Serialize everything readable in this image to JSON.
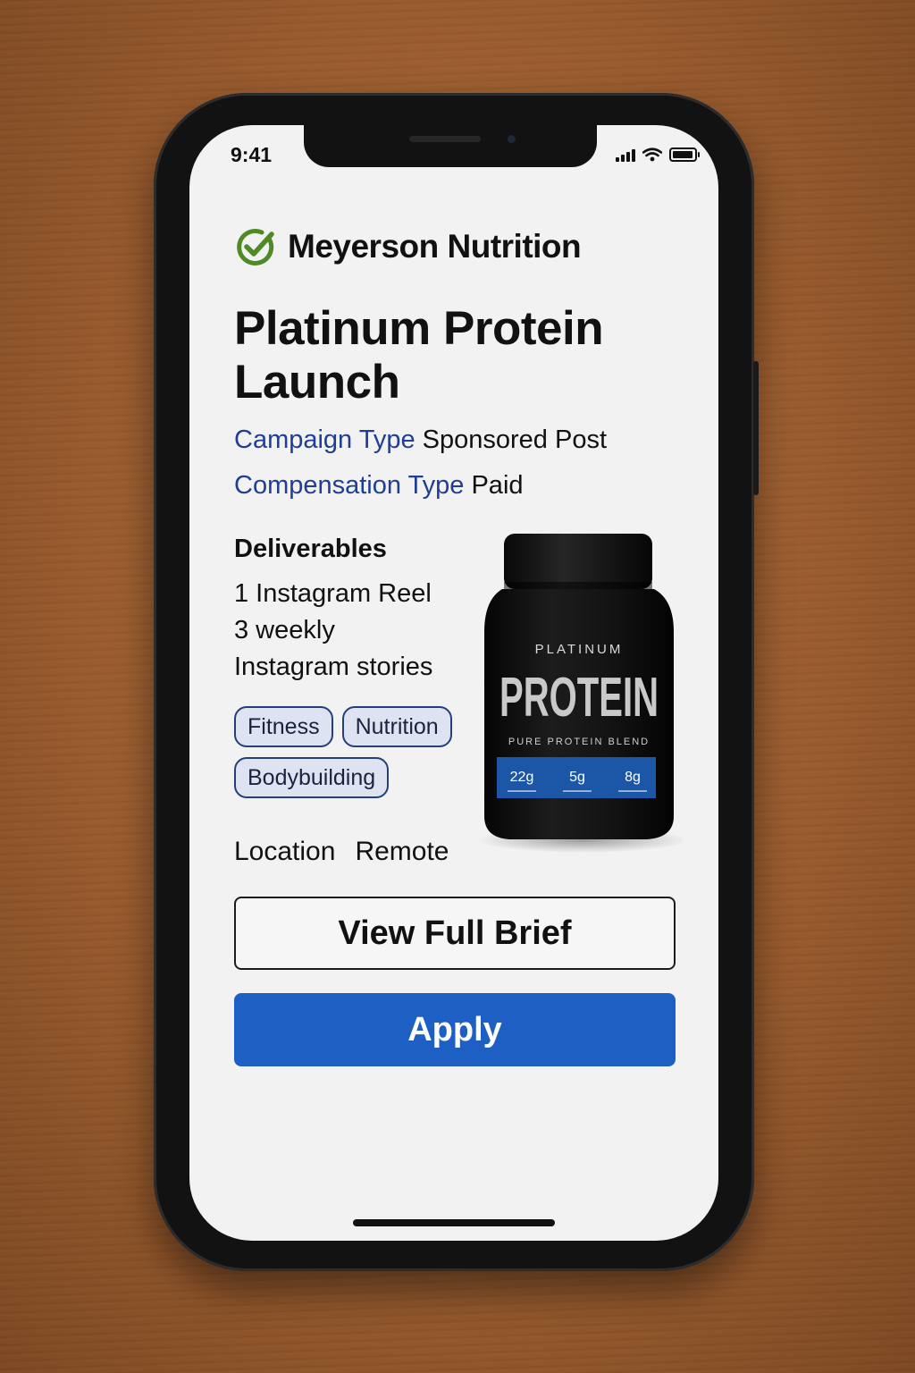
{
  "status_bar": {
    "time": "9:41"
  },
  "brand": {
    "name": "Meyerson Nutrition",
    "check_color": "#4f8a25"
  },
  "campaign": {
    "title": "Platinum Protein Launch",
    "campaign_type_label": "Campaign Type",
    "campaign_type_value": "Sponsored Post",
    "compensation_type_label": "Compensation Type",
    "compensation_type_value": "Paid"
  },
  "deliverables": {
    "heading": "Deliverables",
    "items": [
      "1 Instagram Reel",
      "3 weekly",
      "Instagram stories"
    ]
  },
  "tags": [
    "Fitness",
    "Nutrition",
    "Bodybuilding"
  ],
  "location": {
    "label": "Location",
    "value": "Remote"
  },
  "product_image": {
    "brand_line": "PLATINUM",
    "name": "PROTEIN",
    "tagline": "PURE PROTEIN BLEND",
    "stats": [
      "22g",
      "5g",
      "8g"
    ]
  },
  "actions": {
    "view_brief_label": "View Full Brief",
    "apply_label": "Apply"
  },
  "colors": {
    "accent_blue": "#1d5fc3",
    "label_blue": "#1f3f94",
    "tag_border": "#23407d",
    "tag_bg": "#dfe3f1"
  }
}
